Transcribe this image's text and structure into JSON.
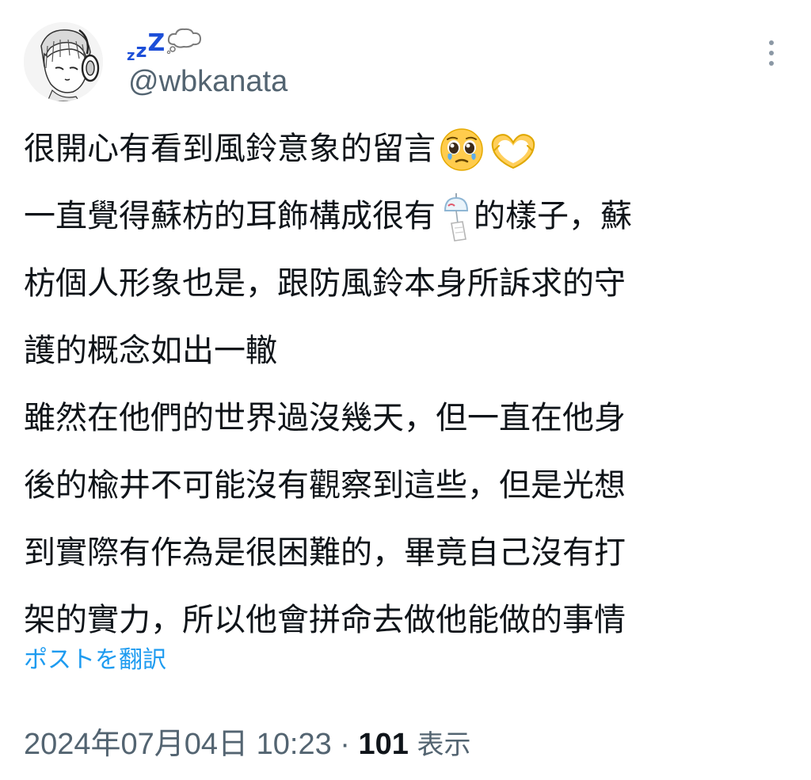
{
  "user": {
    "display_name": "ᶻᶻᶻ💭",
    "display_name_parts": [
      "z",
      "z",
      "Z"
    ],
    "handle": "@wbkanata",
    "avatar_icon": "manga-avatar-with-headphones"
  },
  "menu": {
    "more_icon": "vertical-ellipsis-icon"
  },
  "tweet": {
    "lines": [
      "很開心有看到風鈴意象的留言",
      "一直覺得蘇枋的耳飾構成很有",
      "的樣子，蘇",
      "枋個人形象也是，跟防風鈴本身所訴求的守",
      "護的概念如出一轍",
      "雖然在他們的世界過沒幾天，但一直在他身",
      "後的楡井不可能沒有觀察到這些，但是光想",
      "到實際有作為是很困難的，畢竟自己沒有打",
      "架的實力，所以他會拼命去做他能做的事情"
    ],
    "emojis": {
      "pleading_face": "pleading-face-emoji",
      "heart_hands": "heart-hands-emoji",
      "wind_chime": "wind-chime-emoji"
    }
  },
  "translate": {
    "label": "ポストを翻訳"
  },
  "meta": {
    "timestamp": "2024年07月04日 10:23",
    "separator": "·",
    "views_count": "101",
    "views_label": "表示"
  },
  "colors": {
    "text": "#0f1419",
    "secondary": "#536471",
    "link": "#1d9bf0",
    "zzz": "#1d4fd8"
  }
}
